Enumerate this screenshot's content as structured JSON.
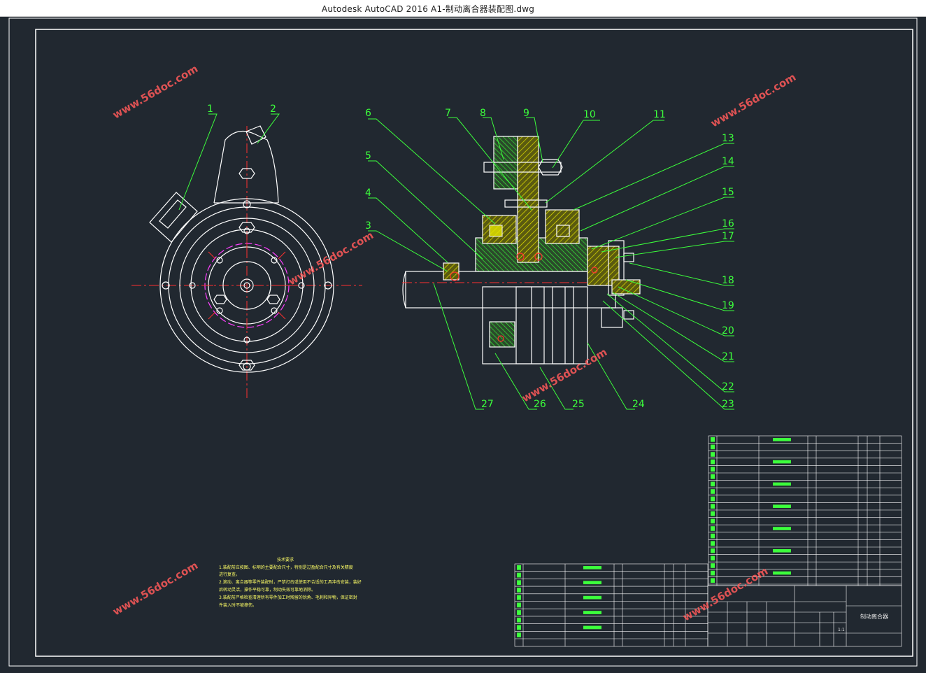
{
  "window": {
    "title": "Autodesk AutoCAD 2016     A1-制动离合器装配图.dwg"
  },
  "drawing": {
    "callouts": [
      "1",
      "2",
      "6",
      "7",
      "8",
      "9",
      "10",
      "11",
      "13",
      "14",
      "15",
      "16",
      "17",
      "18",
      "19",
      "20",
      "21",
      "22",
      "23",
      "24",
      "25",
      "26",
      "27",
      "5",
      "4",
      "3"
    ],
    "tech_requirements": {
      "title": "技术要求",
      "lines": [
        "1.装配前应按图、标明的主要配合尺寸，特别是过盈配合尺寸及有关精度",
        "进行复查。",
        "2.滚动、离合器等零件装配时，严禁打击或使用不合适的工具冲击安装，装好",
        "后转动灵活，操作平稳可靠，制动失效可靠地消除。",
        "3.装配前严格检查清理所有零件加工时残留的锐角、毛刺和异物，保证密封",
        "件装入时不被擦伤。"
      ]
    },
    "title_block": {
      "name": "制动离合器",
      "scale": "1:1"
    },
    "watermark": "www.56doc.com",
    "colors": {
      "background": "#212830",
      "line_white": "#ffffff",
      "line_green": "#3cff3c",
      "centerline_red": "#ff3030",
      "hatch_yellow": "#e6e600",
      "purple": "#ff40ff",
      "table_text": "#e8e8e8"
    }
  }
}
